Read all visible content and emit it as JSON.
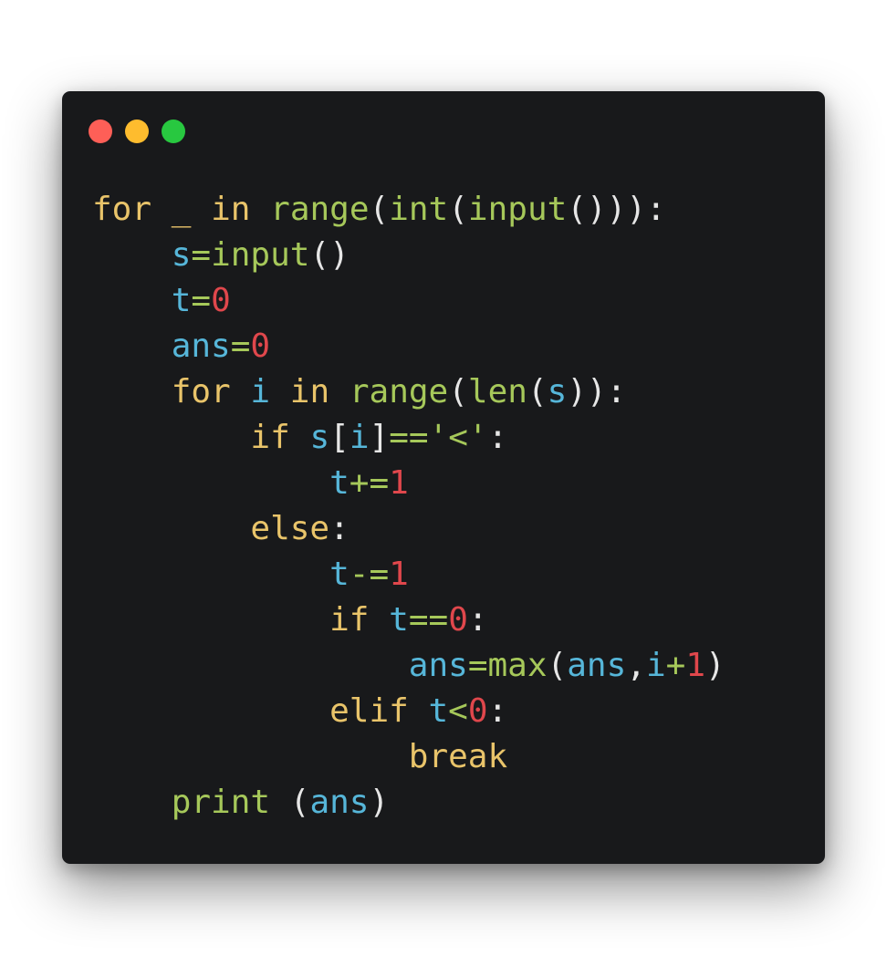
{
  "window": {
    "controls": [
      {
        "name": "close",
        "color": "#fe5f57"
      },
      {
        "name": "minimize",
        "color": "#febc2e"
      },
      {
        "name": "maximize",
        "color": "#28c840"
      }
    ]
  },
  "code": {
    "language": "python",
    "lines": [
      {
        "indent": "",
        "tokens": [
          {
            "t": "for",
            "k": "kw"
          },
          {
            "t": " ",
            "k": "pl"
          },
          {
            "t": "_",
            "k": "kw"
          },
          {
            "t": " ",
            "k": "pl"
          },
          {
            "t": "in",
            "k": "kw"
          },
          {
            "t": " ",
            "k": "pl"
          },
          {
            "t": "range",
            "k": "fn"
          },
          {
            "t": "(",
            "k": "punc"
          },
          {
            "t": "int",
            "k": "fn"
          },
          {
            "t": "(",
            "k": "punc"
          },
          {
            "t": "input",
            "k": "fn"
          },
          {
            "t": "()))",
            "k": "punc"
          },
          {
            "t": ":",
            "k": "punc"
          }
        ]
      },
      {
        "indent": "    ",
        "tokens": [
          {
            "t": "s",
            "k": "var"
          },
          {
            "t": "=",
            "k": "op"
          },
          {
            "t": "input",
            "k": "fn"
          },
          {
            "t": "()",
            "k": "punc"
          }
        ]
      },
      {
        "indent": "    ",
        "tokens": [
          {
            "t": "t",
            "k": "var"
          },
          {
            "t": "=",
            "k": "op"
          },
          {
            "t": "0",
            "k": "num"
          }
        ]
      },
      {
        "indent": "    ",
        "tokens": [
          {
            "t": "ans",
            "k": "var"
          },
          {
            "t": "=",
            "k": "op"
          },
          {
            "t": "0",
            "k": "num"
          }
        ]
      },
      {
        "indent": "    ",
        "tokens": [
          {
            "t": "for",
            "k": "kw"
          },
          {
            "t": " ",
            "k": "pl"
          },
          {
            "t": "i",
            "k": "var"
          },
          {
            "t": " ",
            "k": "pl"
          },
          {
            "t": "in",
            "k": "kw"
          },
          {
            "t": " ",
            "k": "pl"
          },
          {
            "t": "range",
            "k": "fn"
          },
          {
            "t": "(",
            "k": "punc"
          },
          {
            "t": "len",
            "k": "fn"
          },
          {
            "t": "(",
            "k": "punc"
          },
          {
            "t": "s",
            "k": "var"
          },
          {
            "t": "))",
            "k": "punc"
          },
          {
            "t": ":",
            "k": "punc"
          }
        ]
      },
      {
        "indent": "        ",
        "tokens": [
          {
            "t": "if",
            "k": "kw"
          },
          {
            "t": " ",
            "k": "pl"
          },
          {
            "t": "s",
            "k": "var"
          },
          {
            "t": "[",
            "k": "punc"
          },
          {
            "t": "i",
            "k": "var"
          },
          {
            "t": "]",
            "k": "punc"
          },
          {
            "t": "==",
            "k": "op"
          },
          {
            "t": "'<'",
            "k": "str"
          },
          {
            "t": ":",
            "k": "punc"
          }
        ]
      },
      {
        "indent": "            ",
        "tokens": [
          {
            "t": "t",
            "k": "var"
          },
          {
            "t": "+=",
            "k": "op"
          },
          {
            "t": "1",
            "k": "num"
          }
        ]
      },
      {
        "indent": "        ",
        "tokens": [
          {
            "t": "else",
            "k": "kw"
          },
          {
            "t": ":",
            "k": "punc"
          }
        ]
      },
      {
        "indent": "            ",
        "tokens": [
          {
            "t": "t",
            "k": "var"
          },
          {
            "t": "-=",
            "k": "op"
          },
          {
            "t": "1",
            "k": "num"
          }
        ]
      },
      {
        "indent": "            ",
        "tokens": [
          {
            "t": "if",
            "k": "kw"
          },
          {
            "t": " ",
            "k": "pl"
          },
          {
            "t": "t",
            "k": "var"
          },
          {
            "t": "==",
            "k": "op"
          },
          {
            "t": "0",
            "k": "num"
          },
          {
            "t": ":",
            "k": "punc"
          }
        ]
      },
      {
        "indent": "                ",
        "tokens": [
          {
            "t": "ans",
            "k": "var"
          },
          {
            "t": "=",
            "k": "op"
          },
          {
            "t": "max",
            "k": "fn"
          },
          {
            "t": "(",
            "k": "punc"
          },
          {
            "t": "ans",
            "k": "var"
          },
          {
            "t": ",",
            "k": "punc"
          },
          {
            "t": "i",
            "k": "var"
          },
          {
            "t": "+",
            "k": "op"
          },
          {
            "t": "1",
            "k": "num"
          },
          {
            "t": ")",
            "k": "punc"
          }
        ]
      },
      {
        "indent": "            ",
        "tokens": [
          {
            "t": "elif",
            "k": "kw"
          },
          {
            "t": " ",
            "k": "pl"
          },
          {
            "t": "t",
            "k": "var"
          },
          {
            "t": "<",
            "k": "op"
          },
          {
            "t": "0",
            "k": "num"
          },
          {
            "t": ":",
            "k": "punc"
          }
        ]
      },
      {
        "indent": "                ",
        "tokens": [
          {
            "t": "break",
            "k": "kw"
          }
        ]
      },
      {
        "indent": "    ",
        "tokens": [
          {
            "t": "print",
            "k": "fn"
          },
          {
            "t": " ",
            "k": "pl"
          },
          {
            "t": "(",
            "k": "punc"
          },
          {
            "t": "ans",
            "k": "var"
          },
          {
            "t": ")",
            "k": "punc"
          }
        ]
      }
    ]
  },
  "colors": {
    "background": "#18191b",
    "keyword": "#e9c46a",
    "function": "#a6c85a",
    "variable": "#56b6d9",
    "number": "#e0474c",
    "punctuation": "#e6e6e6"
  }
}
